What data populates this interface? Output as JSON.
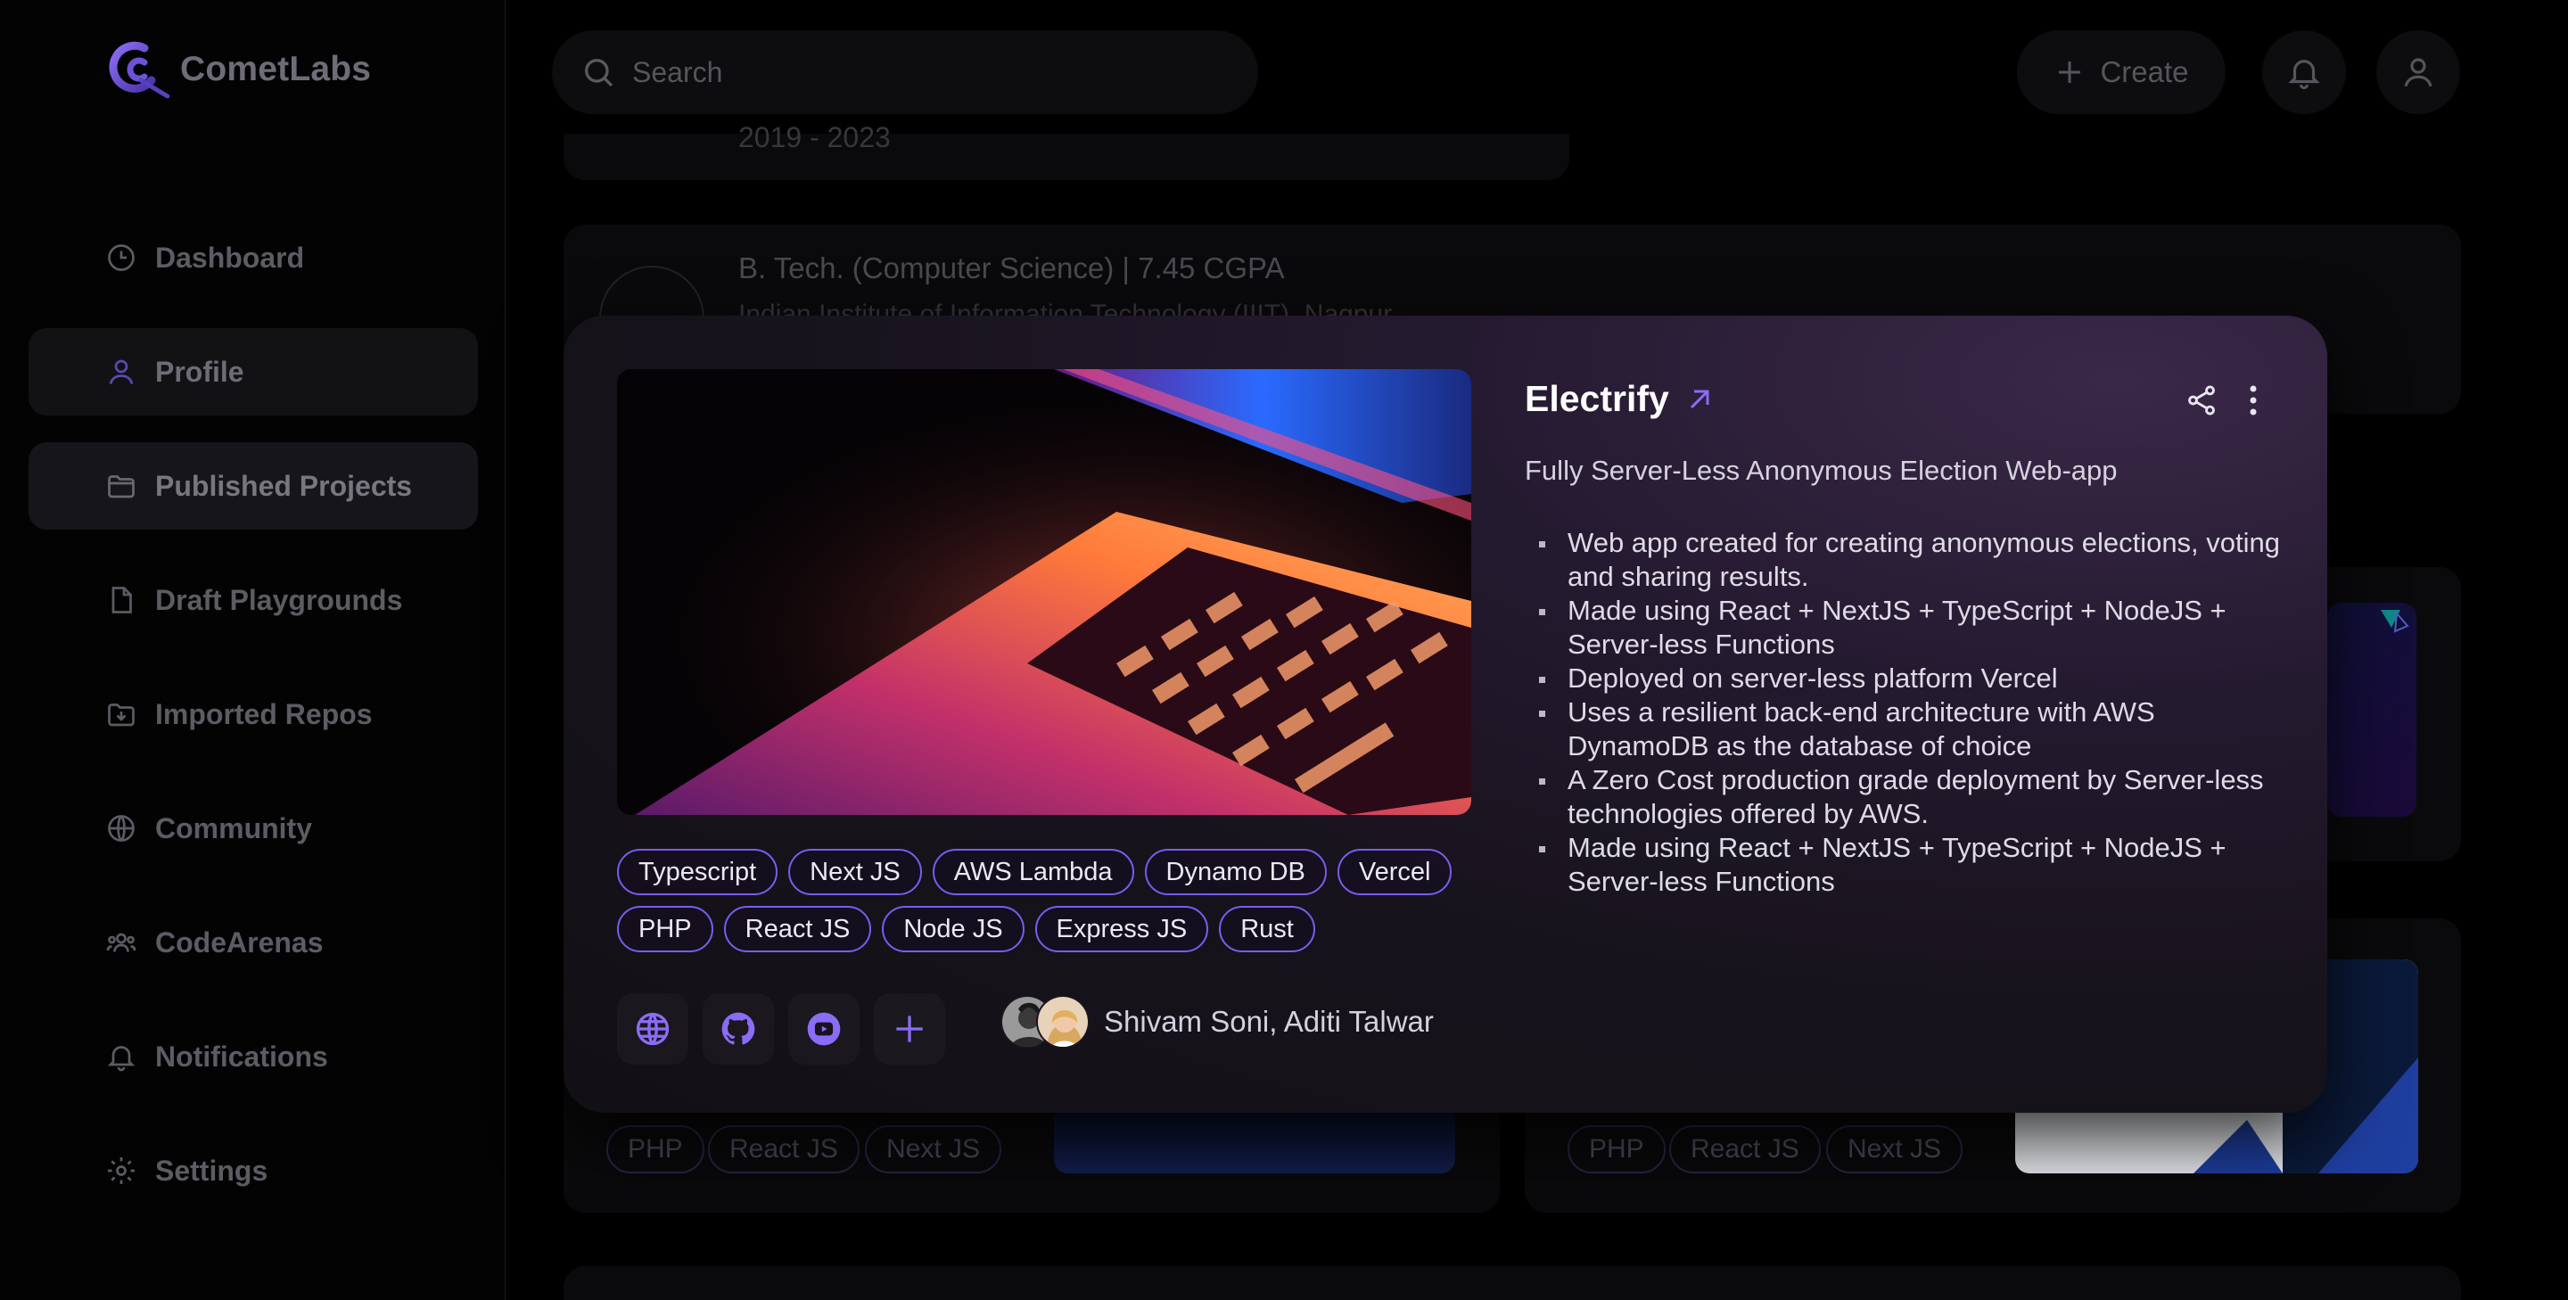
{
  "app": {
    "brand_name": "CometLabs",
    "accent": "#7b5cf0"
  },
  "sidebar": {
    "items": [
      {
        "label": "Dashboard",
        "icon": "clock-icon"
      },
      {
        "label": "Profile",
        "icon": "user-icon"
      },
      {
        "label": "Published Projects",
        "icon": "folder-icon"
      },
      {
        "label": "Draft Playgrounds",
        "icon": "file-icon"
      },
      {
        "label": "Imported Repos",
        "icon": "import-folder-icon"
      },
      {
        "label": "Community",
        "icon": "globe-icon"
      },
      {
        "label": "CodeArenas",
        "icon": "users-icon"
      },
      {
        "label": "Notifications",
        "icon": "bell-icon"
      },
      {
        "label": "Settings",
        "icon": "gear-icon"
      }
    ]
  },
  "topbar": {
    "search_placeholder": "Search",
    "create_label": "Create"
  },
  "background": {
    "edu_years": "2019 - 2023",
    "edu_title": "B. Tech. (Computer Science)  |  7.45 CGPA",
    "edu_sub": "Indian Institute of Information Technology (IIIT), Nagpur",
    "card_chips_left": [
      "PHP",
      "React JS",
      "Next JS"
    ],
    "card_chips_right": [
      "PHP",
      "React JS",
      "Next JS"
    ]
  },
  "project": {
    "title": "Electrify",
    "description": "Fully Server-Less Anonymous Election Web-app",
    "bullets": [
      "Web app created for creating anonymous elections, voting and sharing results.",
      "Made using React + NextJS + TypeScript + NodeJS + Server-less Functions",
      "Deployed on server-less platform Vercel",
      "Uses a resilient back-end architecture with AWS DynamoDB as the database of choice",
      "A Zero Cost production grade deployment by Server-less technologies offered by AWS.",
      "Made using React + NextJS + TypeScript + NodeJS + Server-less Functions"
    ],
    "tags_row1": [
      "Typescript",
      "Next JS",
      "AWS Lambda",
      "Dynamo DB",
      "Vercel"
    ],
    "tags_row2": [
      "PHP",
      "React JS",
      "Node JS",
      "Express JS",
      "Rust"
    ],
    "links": [
      "globe-icon",
      "github-icon",
      "youtube-icon",
      "plus-icon"
    ],
    "authors": "Shivam Soni, Aditi Talwar"
  }
}
